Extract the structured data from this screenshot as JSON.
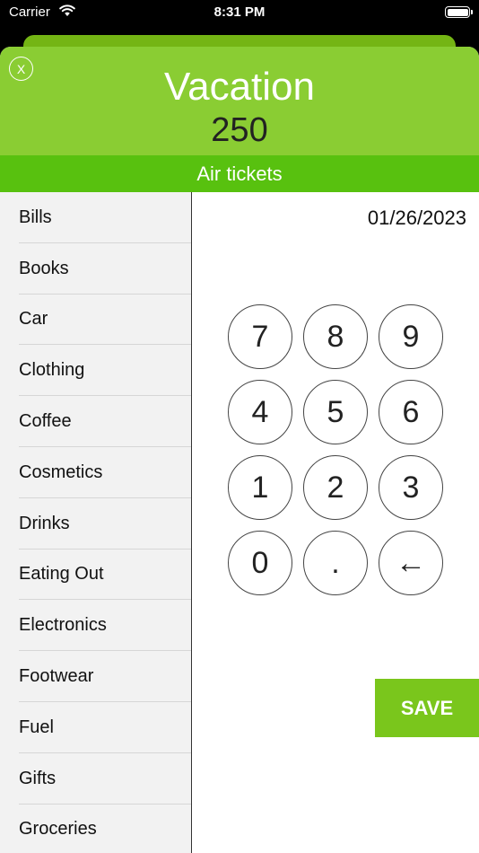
{
  "status_bar": {
    "carrier": "Carrier",
    "time": "8:31 PM"
  },
  "header": {
    "title": "Vacation",
    "amount": "250",
    "close_label": "X"
  },
  "subcategory": "Air tickets",
  "date": "01/26/2023",
  "categories": [
    "Bills",
    "Books",
    "Car",
    "Clothing",
    "Coffee",
    "Cosmetics",
    "Drinks",
    "Eating Out",
    "Electronics",
    "Footwear",
    "Fuel",
    "Gifts",
    "Groceries"
  ],
  "keypad": [
    "7",
    "8",
    "9",
    "4",
    "5",
    "6",
    "1",
    "2",
    "3",
    "0",
    ".",
    "←"
  ],
  "save_label": "SAVE",
  "colors": {
    "header_green": "#8acd33",
    "subcategory_green": "#58c10f",
    "save_green": "#7ac61c"
  }
}
